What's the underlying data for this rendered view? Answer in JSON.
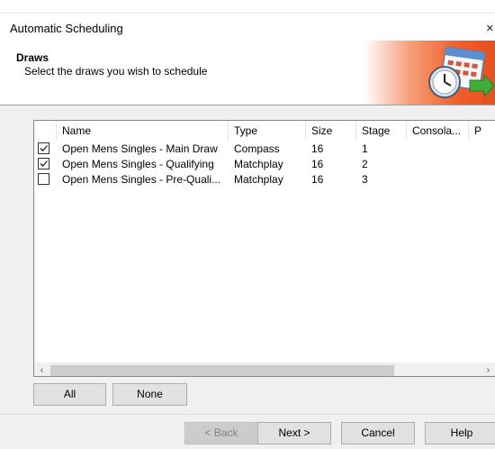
{
  "window": {
    "title": "Automatic Scheduling",
    "close_glyph": "×"
  },
  "header": {
    "title": "Draws",
    "subtitle": "Select the draws you wish to schedule",
    "banner_icon": "calendar-clock-icon"
  },
  "draws_table": {
    "columns": [
      "Name",
      "Type",
      "Size",
      "Stage",
      "Consola...",
      "P"
    ],
    "rows": [
      {
        "checked": true,
        "name": "Open Mens Singles - Main Draw",
        "type": "Compass",
        "size": "16",
        "stage": "1"
      },
      {
        "checked": true,
        "name": "Open Mens Singles - Qualifying",
        "type": "Matchplay",
        "size": "16",
        "stage": "2"
      },
      {
        "checked": false,
        "name": "Open Mens Singles - Pre-Quali...",
        "type": "Matchplay",
        "size": "16",
        "stage": "3"
      }
    ],
    "scroll_left_glyph": "‹",
    "scroll_right_glyph": "›"
  },
  "selection_buttons": {
    "all_label": "All",
    "none_label": "None"
  },
  "footer": {
    "back_label": "< Back",
    "next_label": "Next >",
    "cancel_label": "Cancel",
    "help_label": "Help"
  },
  "colors": {
    "banner_orange": "#f0602a",
    "list_border": "#828790",
    "panel_bg": "#f0f0f0"
  }
}
